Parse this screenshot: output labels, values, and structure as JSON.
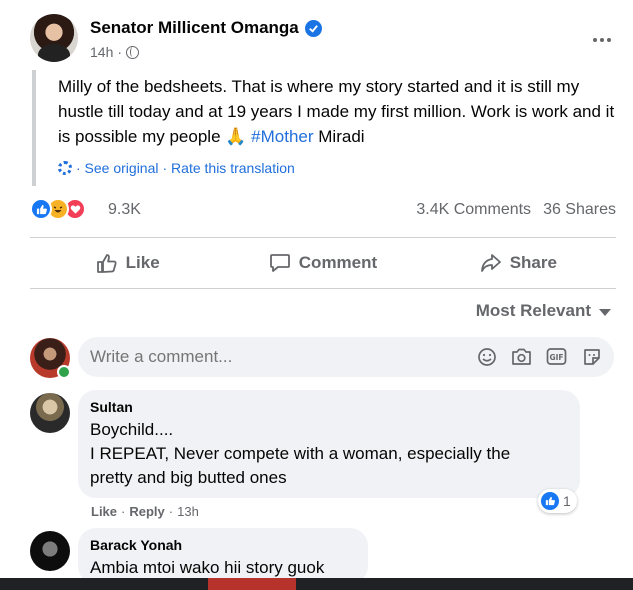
{
  "post": {
    "author": "Senator Millicent Omanga",
    "time": "14h",
    "dot": "·",
    "body": "Milly of the bedsheets. That is where my story started and it is still my hustle till today and at 19 years I made my first million. Work is work and it is possible my people 🙏",
    "hashtag": "#Mother",
    "body_tail": "Miradi",
    "see_original": "· See original",
    "rate_translation": "· Rate this translation"
  },
  "stats": {
    "reactions": "9.3K",
    "comments": "3.4K Comments",
    "shares": "36 Shares"
  },
  "actions": {
    "like": "Like",
    "comment": "Comment",
    "share": "Share"
  },
  "sort": {
    "label": "Most Relevant"
  },
  "composer": {
    "placeholder": "Write a comment..."
  },
  "comments": [
    {
      "name": "Sultan",
      "lines": [
        "Boychild....",
        "I REPEAT, Never compete with a woman, especially the",
        "pretty and big butted ones"
      ],
      "reaction_count": "1",
      "like": "Like",
      "reply": "Reply",
      "time": "13h"
    },
    {
      "name": "Barack Yonah",
      "lines": [
        "Ambia mtoi wako hii story guok"
      ]
    }
  ],
  "colors": {
    "link": "#216fdb",
    "like_blue": "#1877f2",
    "love_red": "#f33e58",
    "haha_yellow": "#f7b125",
    "verified": "#1b74e4",
    "online": "#31a24c"
  }
}
